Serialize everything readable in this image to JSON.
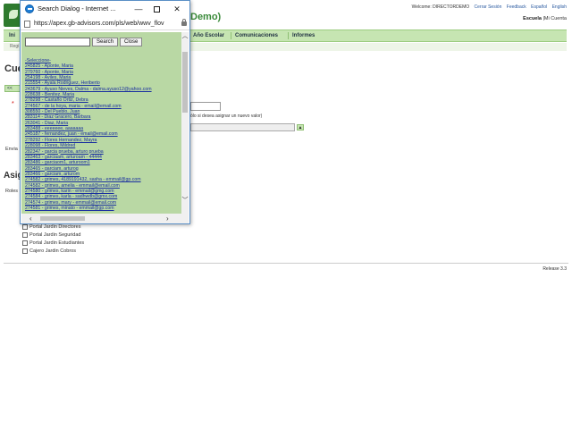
{
  "app": {
    "title_fragment": "Demo)",
    "top_links": {
      "welcome": "Welcome: DIRECTORDEMO",
      "logout": "Cerrar Sesión",
      "feedback": "Feedback",
      "lang_es": "Español",
      "lang_en": "English"
    },
    "school_links": {
      "school": "Escuela",
      "separator": "|",
      "mi_cuenta": "Mi Cuenta"
    },
    "nav_items": [
      "Ini",
      "Año Escolar",
      "Comunicaciones",
      "Informes"
    ],
    "sub_nav": "Regi",
    "section_heading": "Cue",
    "back_button": "<<",
    "required_marker": "*",
    "hint_text": "ólo si desea asignar un nuevo valor)",
    "env_label": "Envia",
    "assign_heading": "Asig",
    "roles_label": "Roles",
    "roles": [
      "Portal Jardin Directores",
      "Portal Jardin Seguridad",
      "Portal Jardin Estudiantes",
      "Cajero Jardin Cobros"
    ],
    "release": "Release 3.3"
  },
  "popup": {
    "window_title": "Search Dialog - Internet ...",
    "window_controls": {
      "minimize": "—",
      "close": "✕"
    },
    "address": "https://apex.gb-advisors.com/pls/web/wwv_flov",
    "search_value": "",
    "search_button": "Search",
    "close_button": "Close",
    "scroll_arrows": {
      "up": "︿",
      "down": "﹀",
      "left": "‹",
      "right": "›"
    },
    "results": [
      "-Seleccione-",
      "245825 - Aponte, Maria",
      "279760 - Aponte, Maria",
      "254198 - Aviles, Maria",
      "215554 - Ayala Rodriguez, Heriberto",
      "243679 - Ayuso Nieves, Dalma - dalma.ayuso12@yahoo.com",
      "228638 - Benitez, Maria",
      "278298 - Castaño Ortiz, Debra",
      "274567 - de la hoya, maria - email@email.com",
      "308550 - Del Pueblo, Juan",
      "283114 - Diaz Gracero, Barbara",
      "263041 - Diaz, Maria",
      "283488 - eeeeeee, aaaaaaa",
      "245187 - fernandez, juan - email@email.com",
      "278292 - Flores Hernandez, Mayra",
      "228098 - Flores, Mildred",
      "282347 - garcia prueba, arturo prueba",
      "283463 - garciaam, arturoam - 44444",
      "283486 - garciaom1, arturoom1",
      "283465 - garciam, arturog",
      "283466 - garciam, arturom",
      "274582 - grimes, 4189191432, sasha - emmail@gp.com",
      "274582 - grimes, amelia - emmail@email.com",
      "274580 - grimes, karin - emmail@gmg.com",
      "274584 - grimes, karla - sadhwdb@gmx.com",
      "274574 - grimes, mary - emmail@email.com",
      "274581 - grimes, minato - emmail@gp.com"
    ]
  }
}
